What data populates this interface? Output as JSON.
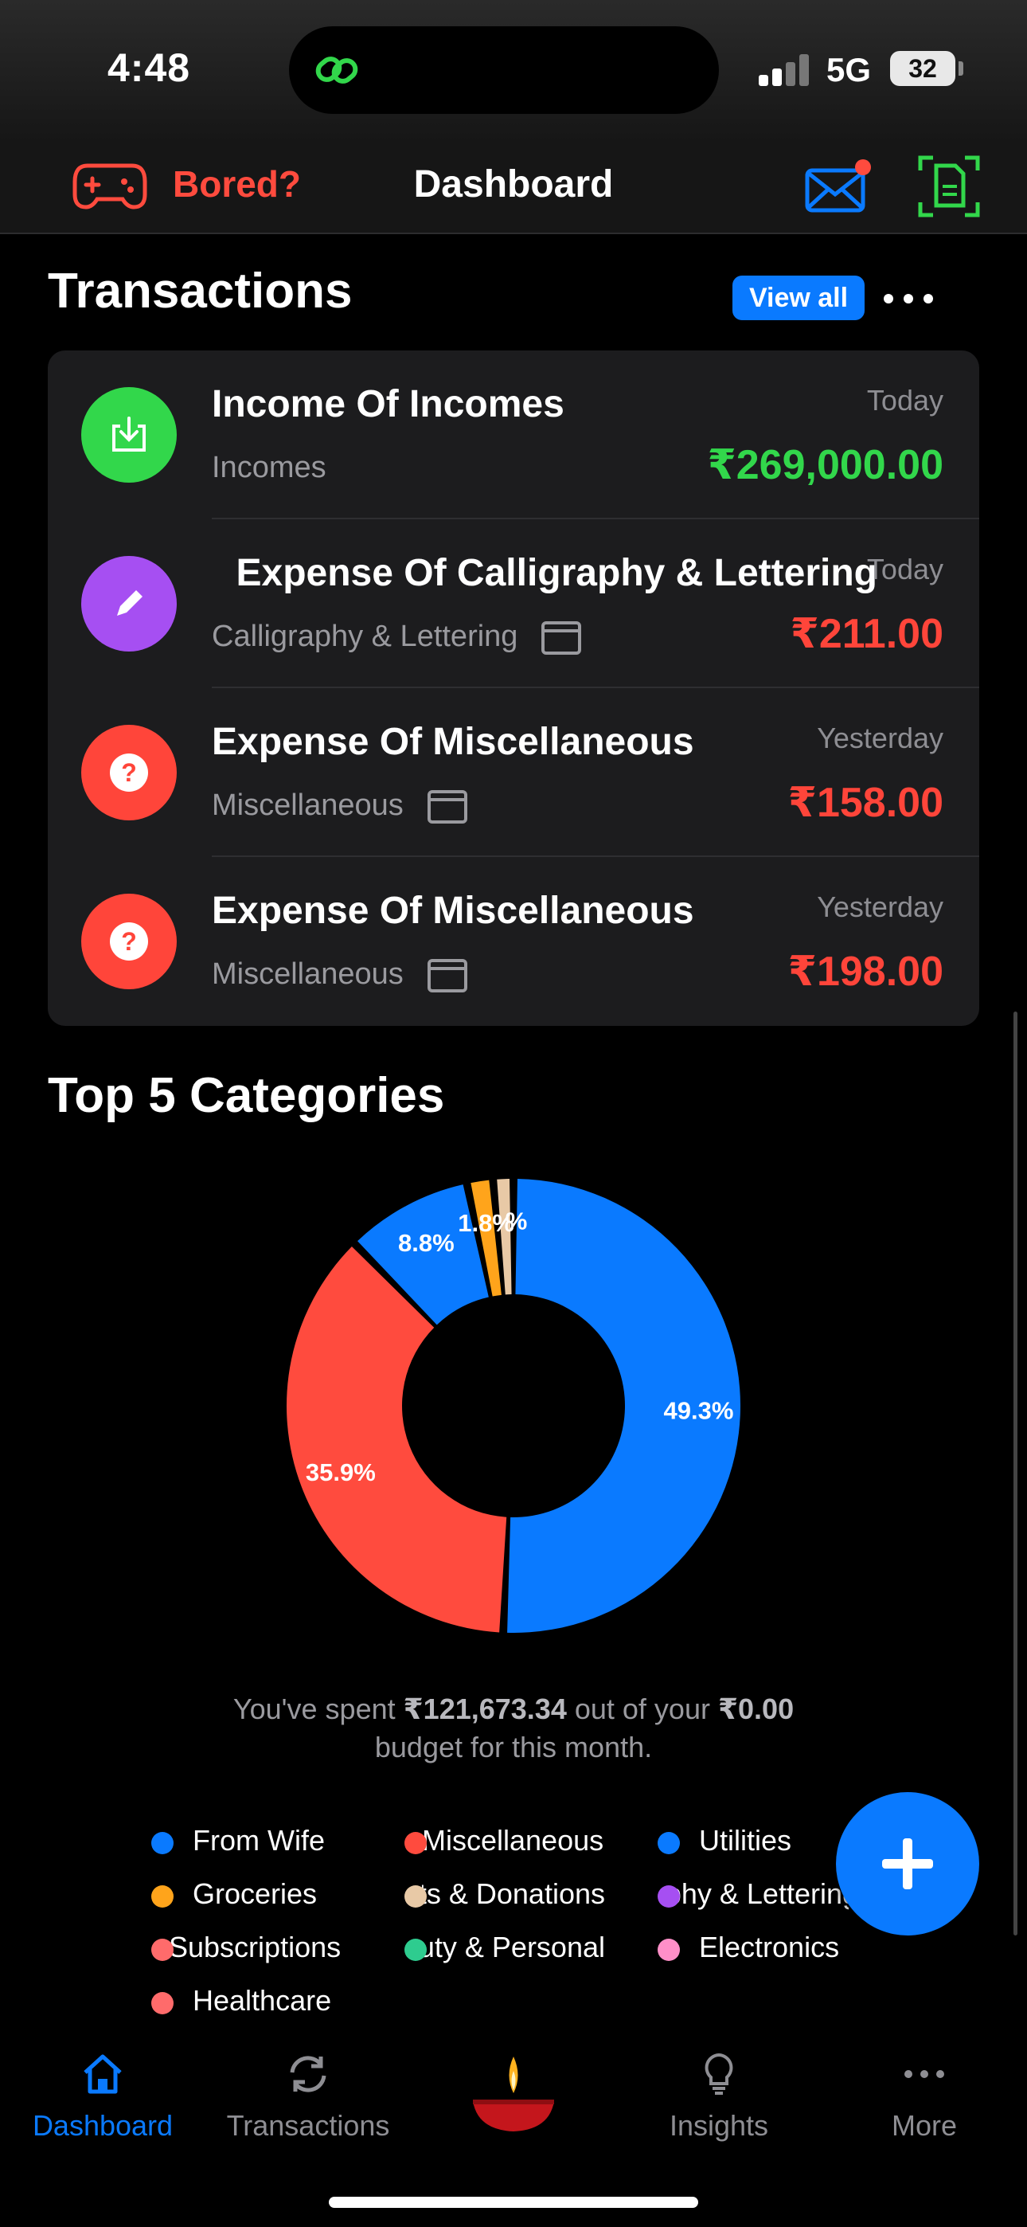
{
  "status": {
    "time": "4:48",
    "network": "5G",
    "battery": "32"
  },
  "header": {
    "bored_label": "Bored?",
    "title": "Dashboard"
  },
  "transactions": {
    "title": "Transactions",
    "view_all": "View all",
    "items": [
      {
        "title": "Income Of Incomes",
        "date": "Today",
        "category": "Incomes",
        "amount": "₹269,000.00",
        "amount_color": "#32d74b",
        "icon": "download-icon",
        "icon_color": "#32d74b"
      },
      {
        "title": "Expense Of Calligraphy & Lettering",
        "date": "Today",
        "category": "Calligraphy & Lettering",
        "amount": "₹211.00",
        "amount_color": "#ff453a",
        "icon": "pencil-icon",
        "icon_color": "#a64ff2"
      },
      {
        "title": "Expense Of Miscellaneous",
        "date": "Yesterday",
        "category": "Miscellaneous",
        "amount": "₹158.00",
        "amount_color": "#ff453a",
        "icon": "question-icon",
        "icon_color": "#ff453a"
      },
      {
        "title": "Expense Of Miscellaneous",
        "date": "Yesterday",
        "category": "Miscellaneous",
        "amount": "₹198.00",
        "amount_color": "#ff453a",
        "icon": "question-icon",
        "icon_color": "#ff453a"
      }
    ]
  },
  "categories": {
    "title": "Top 5 Categories",
    "spent_prefix": "You've spent ",
    "spent_amount": "₹121,673.34",
    "spent_middle": " out of your ",
    "budget_amount": "₹0.00",
    "spent_suffix": " budget for this month.",
    "legend": [
      {
        "label": "From Wife",
        "color": "#0a7aff"
      },
      {
        "label": "Miscellaneous",
        "color": "#ff4b3e"
      },
      {
        "label": "Utilities",
        "color": "#0a7aff"
      },
      {
        "label": "Groceries",
        "color": "#ffa41b"
      },
      {
        "label": "Gifts & Donations",
        "color": "#e8c9a6"
      },
      {
        "label": "Calligraphy & Lettering",
        "color": "#a64ff2"
      },
      {
        "label": "Subscriptions",
        "color": "#ff6b6b"
      },
      {
        "label": "Beauty & Personal",
        "color": "#2ecc8f"
      },
      {
        "label": "Electronics",
        "color": "#ff8fc8"
      },
      {
        "label": "Healthcare",
        "color": "#ff6b6b"
      }
    ]
  },
  "chart_data": {
    "type": "pie",
    "labels": [
      "From Wife",
      "Miscellaneous",
      "Utilities",
      "Groceries",
      "Gifts & Donations"
    ],
    "values": [
      49.3,
      35.9,
      8.8,
      1.8,
      1.4
    ],
    "value_labels": [
      "49.3%",
      "35.9%",
      "8.8%",
      "1.8%",
      "%"
    ],
    "colors": [
      "#0a7aff",
      "#ff4b3e",
      "#0a7aff",
      "#ffa41b",
      "#e8c9a6"
    ],
    "donut": true
  },
  "tabs": [
    {
      "label": "Dashboard",
      "icon": "home-icon",
      "active": true
    },
    {
      "label": "Transactions",
      "icon": "refresh-icon",
      "active": false
    },
    {
      "label": "",
      "icon": "diya-icon",
      "active": false
    },
    {
      "label": "Insights",
      "icon": "lightbulb-icon",
      "active": false
    },
    {
      "label": "More",
      "icon": "more-icon",
      "active": false
    }
  ]
}
